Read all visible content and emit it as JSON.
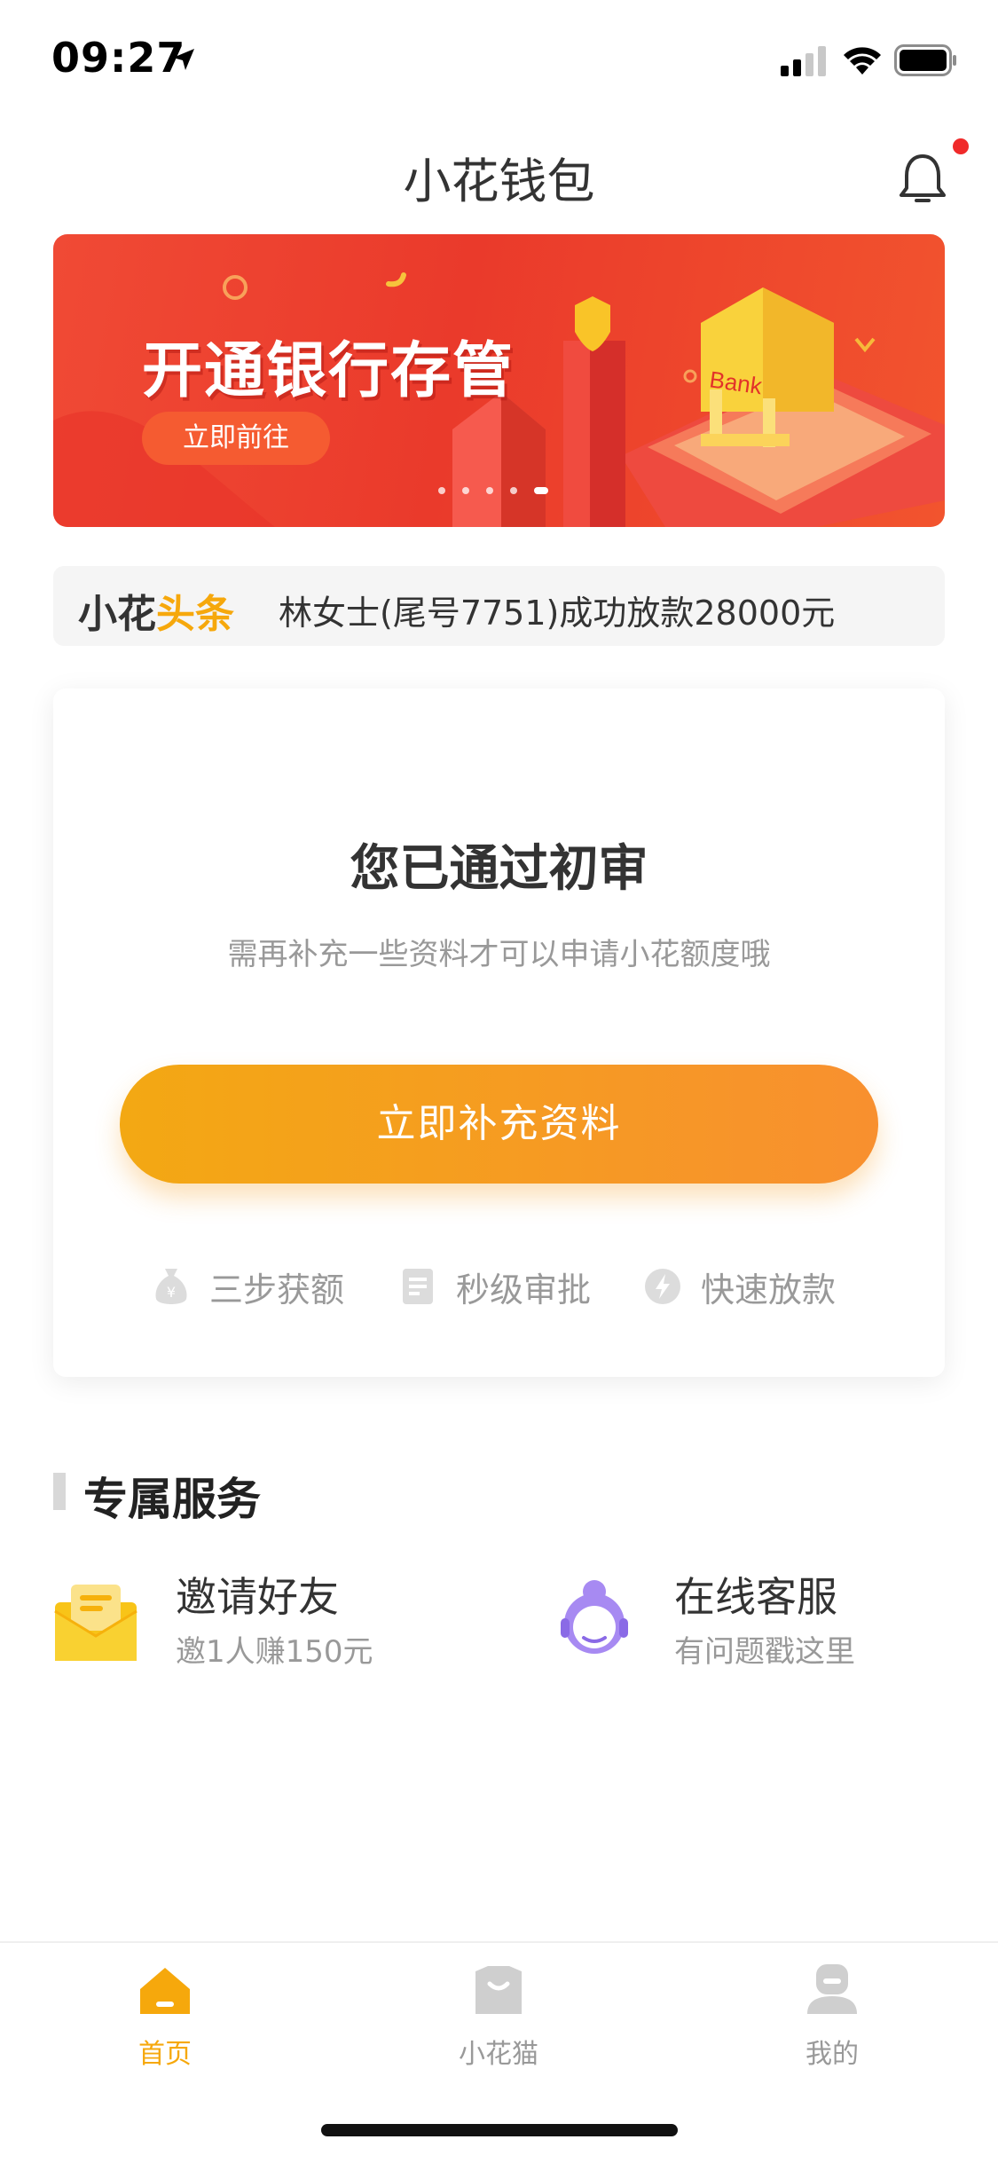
{
  "status_bar": {
    "time": "09:27"
  },
  "nav": {
    "title": "小花钱包"
  },
  "banner": {
    "title": "开通银行存管",
    "button_label": "立即前往",
    "bank_sign": "Bank",
    "slide_count": 5,
    "active_slide": 5
  },
  "news": {
    "brand_part1": "小花",
    "brand_part2": "头条",
    "text": "林女士(尾号7751)成功放款28000元"
  },
  "card": {
    "title": "您已通过初审",
    "subtitle": "需再补充一些资料才可以申请小花额度哦",
    "cta_label": "立即补充资料",
    "features": [
      {
        "icon": "money-bag-icon",
        "label": "三步获额"
      },
      {
        "icon": "document-icon",
        "label": "秒级审批"
      },
      {
        "icon": "lightning-icon",
        "label": "快速放款"
      }
    ]
  },
  "services": {
    "title": "专属服务",
    "items": [
      {
        "icon": "envelope-icon",
        "title": "邀请好友",
        "subtitle": "邀1人赚150元"
      },
      {
        "icon": "customer-service-icon",
        "title": "在线客服",
        "subtitle": "有问题戳这里"
      }
    ]
  },
  "tabbar": {
    "items": [
      {
        "label": "首页",
        "active": true
      },
      {
        "label": "小花猫",
        "active": false
      },
      {
        "label": "我的",
        "active": false
      }
    ]
  },
  "colors": {
    "accent": "#f6a80c",
    "banner_red": "#ea3a2b",
    "inactive": "#999999",
    "notification_dot": "#f02a2a"
  }
}
